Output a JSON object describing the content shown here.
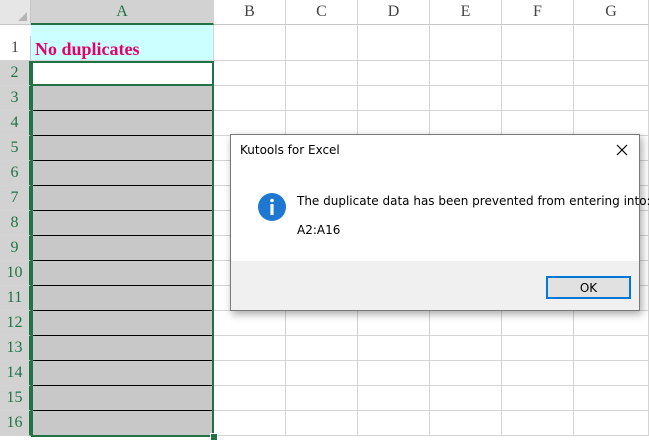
{
  "spreadsheet": {
    "columns": [
      "A",
      "B",
      "C",
      "D",
      "E",
      "F",
      "G"
    ],
    "rows": [
      "1",
      "2",
      "3",
      "4",
      "5",
      "6",
      "7",
      "8",
      "9",
      "10",
      "11",
      "12",
      "13",
      "14",
      "15",
      "16"
    ],
    "cell_a1": "No duplicates",
    "selected_column": "A",
    "selected_range": "A2:A16",
    "colors": {
      "header_fill": "#ccffff",
      "header_text": "#e4006b",
      "shaded_fill": "#c8c8c8",
      "selection": "#217346"
    }
  },
  "dialog": {
    "title": "Kutools for Excel",
    "close_icon": "close-icon",
    "icon": "info-icon",
    "message": "The duplicate data has been prevented from entering into:",
    "range": "A2:A16",
    "ok_label": "OK",
    "accent": "#0078d7"
  }
}
